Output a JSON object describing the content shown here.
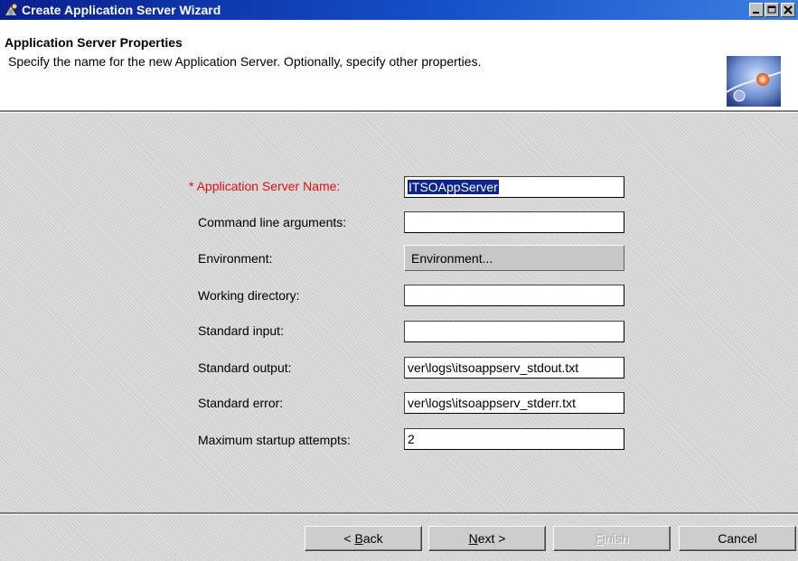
{
  "window": {
    "title": "Create Application Server Wizard"
  },
  "header": {
    "title": "Application Server Properties",
    "description": "Specify the name for the new Application Server.  Optionally, specify other properties."
  },
  "form": {
    "required_marker": "*",
    "app_server_name": {
      "label": "Application Server Name:",
      "value": "ITSOAppServer"
    },
    "command_line_args": {
      "label": "Command line arguments:",
      "value": ""
    },
    "environment": {
      "label": "Environment:",
      "button_label": "Environment..."
    },
    "working_directory": {
      "label": "Working directory:",
      "value": ""
    },
    "standard_input": {
      "label": "Standard input:",
      "value": ""
    },
    "standard_output": {
      "label": "Standard output:",
      "value": "ver\\logs\\itsoappserv_stdout.txt"
    },
    "standard_error": {
      "label": "Standard error:",
      "value": "ver\\logs\\itsoappserv_stderr.txt"
    },
    "max_startup_attempts": {
      "label": "Maximum startup attempts:",
      "value": "2"
    }
  },
  "buttons": {
    "back": {
      "prefix": "< ",
      "mnemonic": "B",
      "rest": "ack"
    },
    "next": {
      "mnemonic": "N",
      "rest": "ext >"
    },
    "finish": {
      "mnemonic": "F",
      "rest": "inish"
    },
    "cancel": "Cancel"
  },
  "colors": {
    "title_bar": "#0a1f8f",
    "required_label": "#e01010",
    "selection": "#0a2490"
  },
  "icons": {
    "app": "server-icon",
    "header_logo": "globe-sun-icon"
  }
}
